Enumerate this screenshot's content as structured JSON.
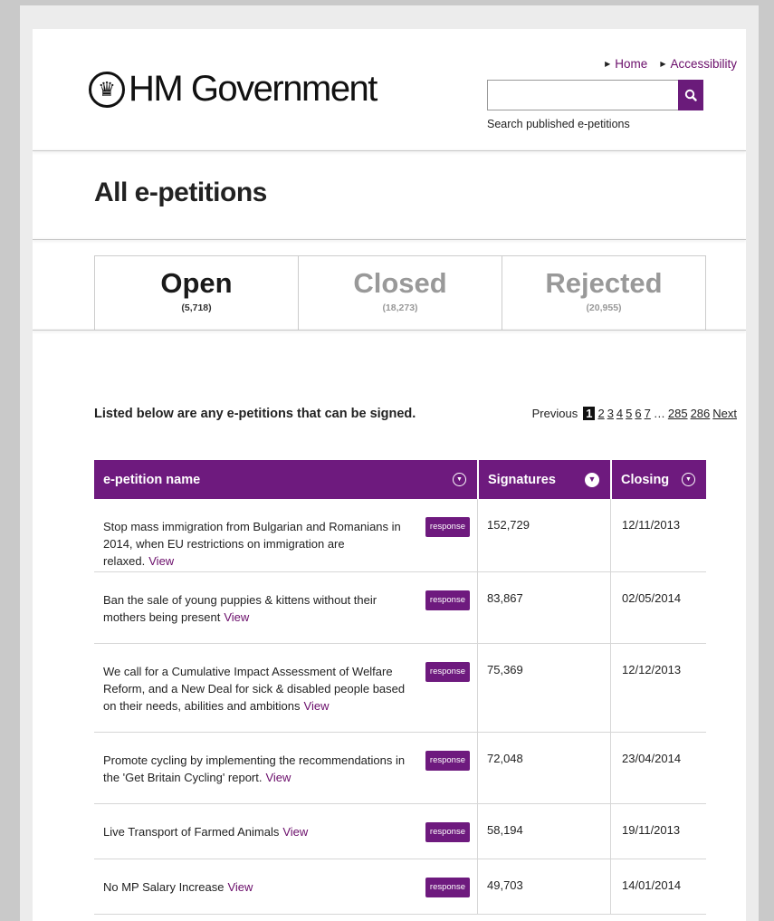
{
  "header": {
    "logo_text": "HM Government",
    "links": [
      {
        "label": "Home"
      },
      {
        "label": "Accessibility"
      }
    ],
    "search": {
      "value": "",
      "label": "Search published e-petitions"
    }
  },
  "page_title": "All e-petitions",
  "tabs": [
    {
      "label": "Open",
      "count": "(5,718)",
      "active": true
    },
    {
      "label": "Closed",
      "count": "(18,273)",
      "active": false
    },
    {
      "label": "Rejected",
      "count": "(20,955)",
      "active": false
    }
  ],
  "listing": {
    "intro": "Listed below are any e-petitions that can be signed.",
    "pagination": {
      "previous": "Previous",
      "current": "1",
      "pages": [
        "2",
        "3",
        "4",
        "5",
        "6",
        "7"
      ],
      "ellipsis": "…",
      "last_pages": [
        "285",
        "286"
      ],
      "next": "Next"
    },
    "columns": [
      "e-petition name",
      "Signatures",
      "Closing"
    ],
    "rows": [
      {
        "name": "Stop mass immigration from Bulgarian and Romanians in 2014, when EU restrictions on immigration are relaxed.",
        "view": "View",
        "badge": "response",
        "signatures": "152,729",
        "closing": "12/11/2013"
      },
      {
        "name": "Ban the sale of young puppies & kittens without their mothers being present",
        "view": "View",
        "badge": "response",
        "signatures": "83,867",
        "closing": "02/05/2014"
      },
      {
        "name": "We call for a Cumulative Impact Assessment of Welfare Reform, and a New Deal for sick & disabled people based on their needs, abilities and ambitions",
        "view": "View",
        "badge": "response",
        "signatures": "75,369",
        "closing": "12/12/2013"
      },
      {
        "name": "Promote cycling by implementing the recommendations in the 'Get Britain Cycling' report.",
        "view": "View",
        "badge": "response",
        "signatures": "72,048",
        "closing": "23/04/2014"
      },
      {
        "name": "Live Transport of Farmed Animals",
        "view": "View",
        "badge": "response",
        "signatures": "58,194",
        "closing": "19/11/2013"
      },
      {
        "name": "No MP Salary Increase",
        "view": "View",
        "badge": "response",
        "signatures": "49,703",
        "closing": "14/01/2014"
      }
    ]
  },
  "colors": {
    "brand_purple": "#6e1a7e",
    "link_purple": "#6a0d6a"
  },
  "icons": [
    "crest-icon",
    "search-icon",
    "triangle-right-icon",
    "sort-icon"
  ]
}
